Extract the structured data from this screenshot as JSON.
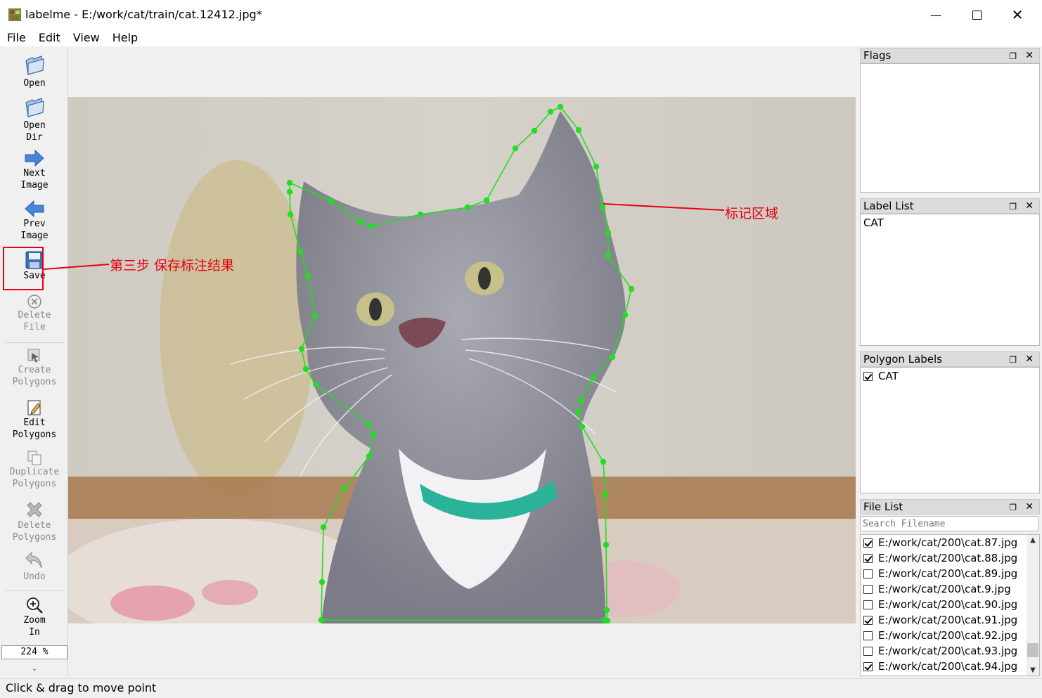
{
  "window": {
    "title": "labelme - E:/work/cat/train/cat.12412.jpg*"
  },
  "menu": [
    "File",
    "Edit",
    "View",
    "Help"
  ],
  "toolbar": {
    "open": "Open",
    "open_dir": "Open\nDir",
    "next_image": "Next\nImage",
    "prev_image": "Prev\nImage",
    "save": "Save",
    "delete_file": "Delete\nFile",
    "create_polygons": "Create\nPolygons",
    "edit_polygons": "Edit\nPolygons",
    "duplicate_polygons": "Duplicate\nPolygons",
    "delete_polygons": "Delete\nPolygons",
    "undo": "Undo",
    "zoom_in": "Zoom\nIn",
    "zoom_value": "224 %",
    "more": "⌄"
  },
  "annotations": {
    "save_step": "第三步 保存标注结果",
    "region": "标记区域"
  },
  "docks": {
    "flags": {
      "title": "Flags"
    },
    "label_list": {
      "title": "Label List",
      "items": [
        "CAT"
      ]
    },
    "polygon_labels": {
      "title": "Polygon Labels",
      "items": [
        {
          "label": "CAT",
          "checked": true
        }
      ]
    },
    "file_list": {
      "title": "File List",
      "search_placeholder": "Search Filename",
      "files": [
        {
          "name": "E:/work/cat/200\\cat.87.jpg",
          "checked": true
        },
        {
          "name": "E:/work/cat/200\\cat.88.jpg",
          "checked": true
        },
        {
          "name": "E:/work/cat/200\\cat.89.jpg",
          "checked": false
        },
        {
          "name": "E:/work/cat/200\\cat.9.jpg",
          "checked": false
        },
        {
          "name": "E:/work/cat/200\\cat.90.jpg",
          "checked": false
        },
        {
          "name": "E:/work/cat/200\\cat.91.jpg",
          "checked": true
        },
        {
          "name": "E:/work/cat/200\\cat.92.jpg",
          "checked": false
        },
        {
          "name": "E:/work/cat/200\\cat.93.jpg",
          "checked": false
        },
        {
          "name": "E:/work/cat/200\\cat.94.jpg",
          "checked": true
        }
      ]
    }
  },
  "status": "Click & drag to move point",
  "colors": {
    "polygon": "#22dd22",
    "annotation": "#e60012"
  }
}
